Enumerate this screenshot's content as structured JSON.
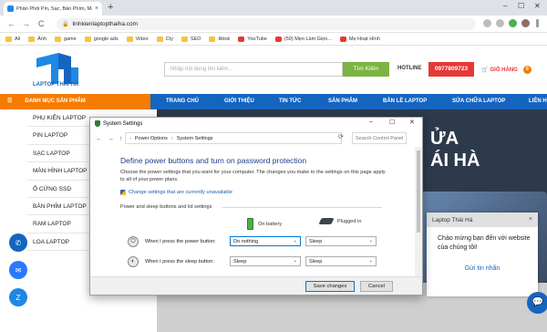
{
  "browser": {
    "tab_title": "Phân Phối Pin, Sạc, Bàn Phím, Mà...",
    "tab_close": "×",
    "new_tab": "+",
    "minimize": "–",
    "maximize": "☐",
    "close": "✕",
    "back": "←",
    "forward": "→",
    "reload": "C",
    "lock": "🔒",
    "url": "linhkienlaptopthaiha.com",
    "bookmarks": [
      {
        "label": "Ali",
        "icon": "folder-icon"
      },
      {
        "label": "Ảnh",
        "icon": "folder-icon"
      },
      {
        "label": "game",
        "icon": "folder-icon"
      },
      {
        "label": "google ads",
        "icon": "folder-icon"
      },
      {
        "label": "Video",
        "icon": "folder-icon"
      },
      {
        "label": "Cty",
        "icon": "folder-icon"
      },
      {
        "label": "SEO",
        "icon": "folder-icon"
      },
      {
        "label": "tiktok",
        "icon": "folder-icon"
      },
      {
        "label": "YouTube",
        "icon": "youtube-icon"
      },
      {
        "label": "(50) Mẹo Làm Giọn...",
        "icon": "youtube-icon"
      },
      {
        "label": "Mẹ Hoạt Hình",
        "icon": "youtube-icon"
      }
    ]
  },
  "site": {
    "logo_text": "LAPTOP THÁI HÀ",
    "search_placeholder": "Nhập nội dung tìm kiếm...",
    "search_button": "Tìm Kiếm",
    "hotline_label": "HOTLINE",
    "hotline_number": "0977809723",
    "cart_label": "GIỎ HÀNG",
    "cart_count": "0",
    "category_menu": "DANH MỤC SẢN PHẨM",
    "nav": [
      "TRANG CHỦ",
      "GIỚI THIỆU",
      "TIN TỨC",
      "SẢN PHẨM",
      "BẢN LỀ LAPTOP",
      "SỬA CHỮA LAPTOP",
      "LIÊN H"
    ],
    "sidebar": [
      "PHỤ KIỆN LAPTOP",
      "PIN LAPTOP",
      "SẠC LAPTOP",
      "MÀN HÌNH LAPTOP",
      "Ổ CỨNG SSD",
      "BÀN PHÍM LAPTOP",
      "RAM LAPTOP",
      "LOA LAPTOP"
    ],
    "banner_text_1": "ỬA",
    "banner_text_2": "ÁI HÀ",
    "chat": {
      "header": "Laptop Thái Hà",
      "close": "×",
      "message": "Chào mừng bạn đến với website của chúng tôi!",
      "cta": "Gửi tin nhắn"
    }
  },
  "dialog": {
    "title": "System Settings",
    "crumb_1": "Power Options",
    "crumb_2": "System Settings",
    "search_placeholder": "Search Control Panel",
    "heading": "Define power buttons and turn on password protection",
    "description": "Choose the power settings that you want for your computer. The changes you make to the settings on this page apply to all of your power plans.",
    "change_link": "Change settings that are currently unavailable",
    "section_label": "Power and sleep buttons and lid settings",
    "col_battery": "On battery",
    "col_plugged": "Plugged in",
    "rows": [
      {
        "label": "When I press the power button:",
        "battery": "Do nothing",
        "plugged": "Sleep"
      },
      {
        "label": "When I press the sleep button:",
        "battery": "Sleep",
        "plugged": "Sleep"
      }
    ],
    "save": "Save changes",
    "cancel": "Cancel"
  }
}
